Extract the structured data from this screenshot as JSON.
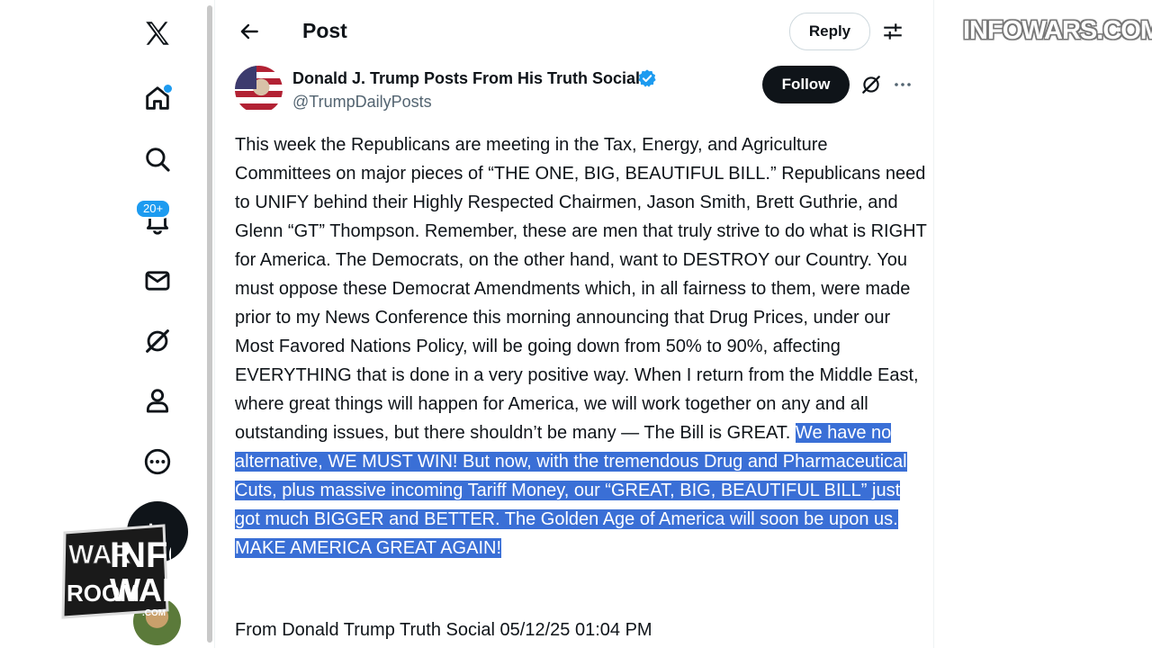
{
  "header": {
    "title": "Post",
    "reply_label": "Reply"
  },
  "nav": {
    "notifications_badge": "20+"
  },
  "author": {
    "name": "Donald J. Trump Posts From His Truth Social",
    "handle": "@TrumpDailyPosts",
    "follow_label": "Follow"
  },
  "post": {
    "text_plain": "This week the Republicans are meeting in the Tax, Energy, and Agriculture Committees on major pieces of “THE ONE, BIG, BEAUTIFUL BILL.” Republicans need to UNIFY behind their Highly Respected Chairmen, Jason Smith, Brett Guthrie, and Glenn “GT” Thompson. Remember, these are men that truly strive to do what is RIGHT for America. The Democrats, on the other hand, want to DESTROY our Country. You must oppose these Democrat Amendments which, in all fairness to them, were made prior to my News Conference this morning announcing that Drug Prices, under our Most Favored Nations Policy, will be going down from 50% to 90%, affecting EVERYTHING that is done in a very positive way. When I return from the Middle East, where great things will happen for America, we will work together on any and all outstanding issues, but there shouldn’t be many — The Bill is GREAT. ",
    "text_highlighted": "We have no alternative, WE MUST WIN! But now, with the tremendous Drug and Pharmaceutical Cuts, plus massive incoming Tariff Money, our “GREAT, BIG, BEAUTIFUL BILL” just got much BIGGER and BETTER. The Golden Age of America will soon be upon us. MAKE AMERICA GREAT AGAIN!",
    "footer": "From Donald Trump Truth Social 05/12/25 01:04 PM"
  },
  "watermark": {
    "top_right": "INFOWARS.COM",
    "logo_text": "WAR ROOM INFOWARS .COM"
  },
  "colors": {
    "accent": "#1d9bf0",
    "highlight": "#3a6fd6",
    "text": "#0f1419",
    "secondary_text": "#536471"
  },
  "icons": [
    "x-logo-icon",
    "home-icon",
    "search-icon",
    "bell-icon",
    "mail-icon",
    "grok-icon",
    "profile-icon",
    "more-circle-icon",
    "compose-icon",
    "back-arrow-icon",
    "tune-icon",
    "verified-badge-icon",
    "ellipsis-icon"
  ]
}
